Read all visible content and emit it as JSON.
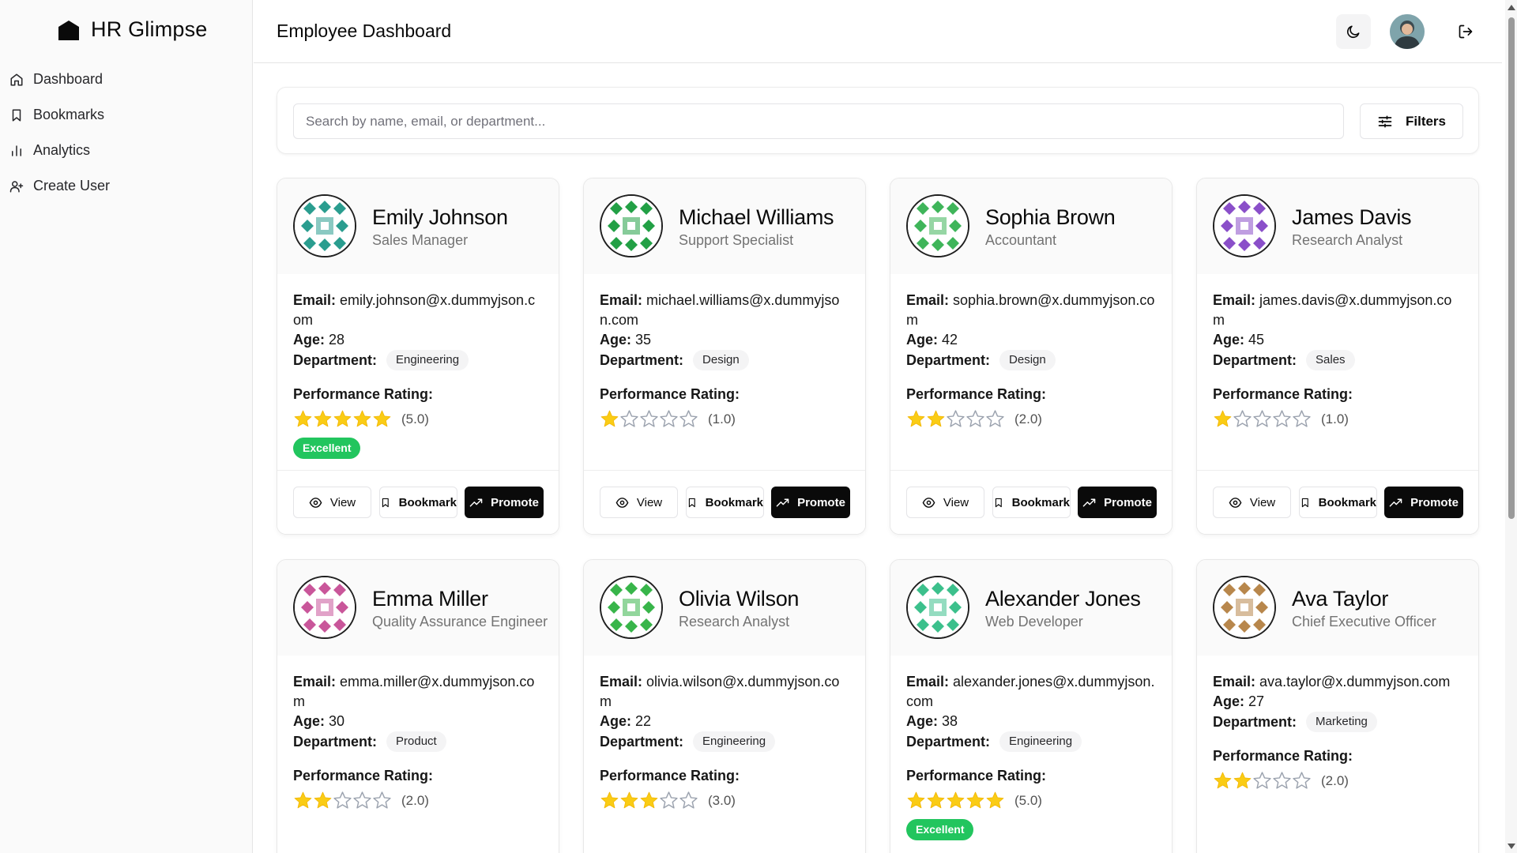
{
  "app": {
    "brand": "HR Glimpse"
  },
  "sidebar": {
    "items": [
      {
        "label": "Dashboard",
        "icon": "home-icon"
      },
      {
        "label": "Bookmarks",
        "icon": "bookmark-icon"
      },
      {
        "label": "Analytics",
        "icon": "bar-chart-icon"
      },
      {
        "label": "Create User",
        "icon": "user-plus-icon"
      }
    ]
  },
  "header": {
    "title": "Employee Dashboard"
  },
  "search": {
    "placeholder": "Search by name, email, or department...",
    "value": "",
    "filters_label": "Filters"
  },
  "labels": {
    "email": "Email:",
    "age": "Age:",
    "department": "Department:",
    "performance": "Performance Rating:",
    "view": "View",
    "bookmark": "Bookmark",
    "promote": "Promote",
    "excellent": "Excellent"
  },
  "colors": {
    "star": "#facc15",
    "excellent_badge": "#22c55e",
    "promote_button": "#0a0a0a"
  },
  "employees": [
    {
      "name": "Emily Johnson",
      "role": "Sales Manager",
      "email": "emily.johnson@x.dummyjson.com",
      "age": "28",
      "department": "Engineering",
      "rating": 5,
      "rating_text": "(5.0)",
      "excellent": true,
      "avatar_color": "#2a9d8f"
    },
    {
      "name": "Michael Williams",
      "role": "Support Specialist",
      "email": "michael.williams@x.dummyjson.com",
      "age": "35",
      "department": "Design",
      "rating": 1,
      "rating_text": "(1.0)",
      "excellent": false,
      "avatar_color": "#22a045"
    },
    {
      "name": "Sophia Brown",
      "role": "Accountant",
      "email": "sophia.brown@x.dummyjson.com",
      "age": "42",
      "department": "Design",
      "rating": 2,
      "rating_text": "(2.0)",
      "excellent": false,
      "avatar_color": "#3fb55a"
    },
    {
      "name": "James Davis",
      "role": "Research Analyst",
      "email": "james.davis@x.dummyjson.com",
      "age": "45",
      "department": "Sales",
      "rating": 1,
      "rating_text": "(1.0)",
      "excellent": false,
      "avatar_color": "#8a4fc9"
    },
    {
      "name": "Emma Miller",
      "role": "Quality Assurance Engineer",
      "email": "emma.miller@x.dummyjson.com",
      "age": "30",
      "department": "Product",
      "rating": 2,
      "rating_text": "(2.0)",
      "excellent": false,
      "avatar_color": "#c9569a"
    },
    {
      "name": "Olivia Wilson",
      "role": "Research Analyst",
      "email": "olivia.wilson@x.dummyjson.com",
      "age": "22",
      "department": "Engineering",
      "rating": 3,
      "rating_text": "(3.0)",
      "excellent": false,
      "avatar_color": "#38b54a"
    },
    {
      "name": "Alexander Jones",
      "role": "Web Developer",
      "email": "alexander.jones@x.dummyjson.com",
      "age": "38",
      "department": "Engineering",
      "rating": 5,
      "rating_text": "(5.0)",
      "excellent": true,
      "avatar_color": "#3cc08c"
    },
    {
      "name": "Ava Taylor",
      "role": "Chief Executive Officer",
      "email": "ava.taylor@x.dummyjson.com",
      "age": "27",
      "department": "Marketing",
      "rating": 2,
      "rating_text": "(2.0)",
      "excellent": false,
      "avatar_color": "#b8874c"
    }
  ]
}
